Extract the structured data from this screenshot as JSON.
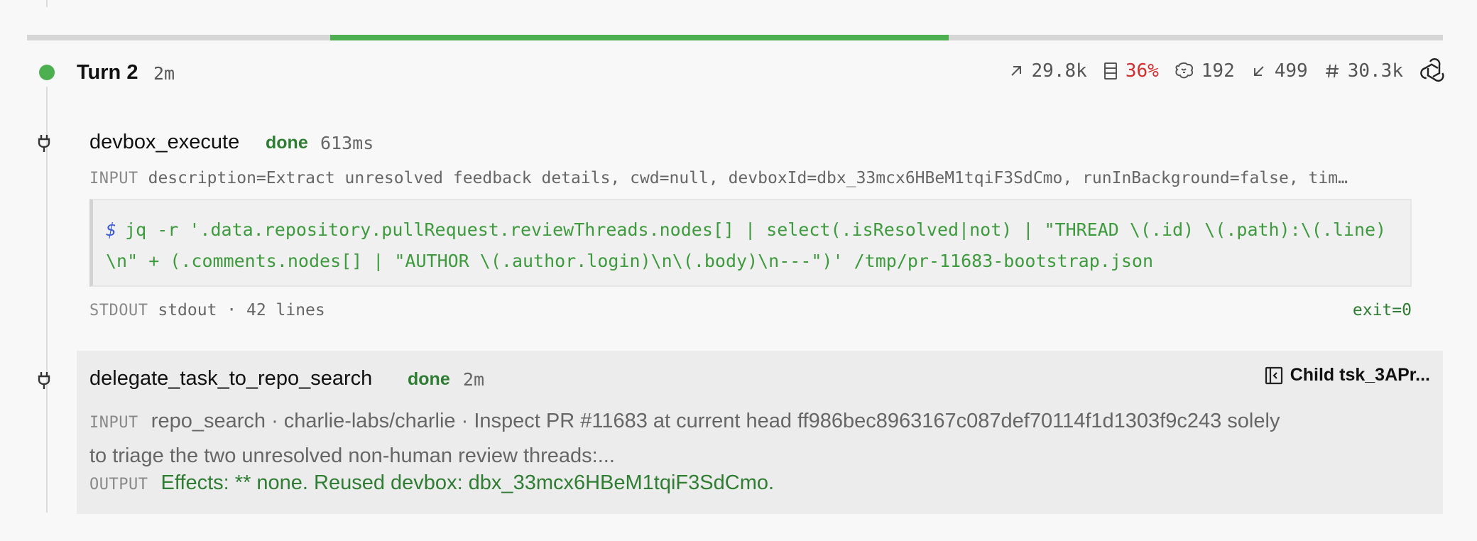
{
  "progress": {
    "start_fraction": 0.214,
    "end_fraction": 0.651,
    "fill_color": "#4caf50"
  },
  "turn": {
    "title": "Turn 2",
    "duration": "2m",
    "status_color": "#4caf50",
    "stats": {
      "tokens_out": "29.8k",
      "context_pct": "36%",
      "reasoning": "192",
      "tokens_in": "499",
      "total": "30.3k"
    }
  },
  "tool1": {
    "name": "devbox_execute",
    "status": "done",
    "duration": "613ms",
    "input_label": "INPUT",
    "input_text": "description=Extract unresolved feedback details, cwd=null, devboxId=dbx_33mcx6HBeM1tqiF3SdCmo, runInBackground=false, tim…",
    "prompt": "$",
    "command": "jq -r '.data.repository.pullRequest.reviewThreads.nodes[] | select(.isResolved|not) | \"THREAD \\(.id) \\(.path):\\(.line)\\n\" + (.comments.nodes[] | \"AUTHOR \\(.author.login)\\n\\(.body)\\n---\")' /tmp/pr-11683-bootstrap.json",
    "stdout_label": "STDOUT",
    "stdout_text": "stdout · 42 lines",
    "exit": "exit=0"
  },
  "tool2": {
    "name": "delegate_task_to_repo_search",
    "status": "done",
    "duration": "2m",
    "child_label": "Child tsk_3APr...",
    "input_label": "INPUT",
    "input_text": "repo_search · charlie-labs/charlie · Inspect PR #11683 at current head ff986bec8963167c087def70114f1d1303f9c243 solely to triage the two unresolved non-human review threads:...",
    "output_label": "OUTPUT",
    "output_text": "Effects: ** none. Reused devbox: dbx_33mcx6HBeM1tqiF3SdCmo."
  }
}
